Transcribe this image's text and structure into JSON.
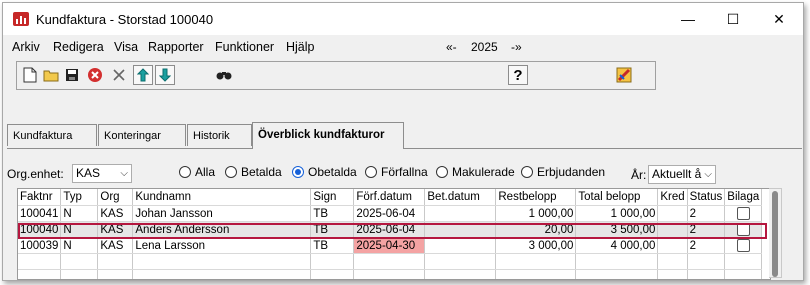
{
  "window": {
    "title": "Kundfaktura - Storstad 100040"
  },
  "menu": [
    "Arkiv",
    "Redigera",
    "Visa",
    "Rapporter",
    "Funktioner",
    "Hjälp"
  ],
  "year_nav": {
    "prev": "«-",
    "year": "2025",
    "next": "-»"
  },
  "toolbar": {
    "icons": [
      "new-document-icon",
      "open-folder-icon",
      "save-icon",
      "delete-icon",
      "cancel-icon",
      "move-up-icon",
      "move-down-icon",
      "search-icon",
      "help-icon",
      "settings-icon"
    ]
  },
  "tabs": [
    "Kundfaktura",
    "Konteringar",
    "Historik",
    "Överblick kundfakturor"
  ],
  "filters": {
    "org_label": "Org.enhet:",
    "org_value": "KAS",
    "radios": [
      {
        "label": "Alla",
        "checked": false
      },
      {
        "label": "Betalda",
        "checked": false
      },
      {
        "label": "Obetalda",
        "checked": true
      },
      {
        "label": "Förfallna",
        "checked": false
      },
      {
        "label": "Makulerade",
        "checked": false
      },
      {
        "label": "Erbjudanden",
        "checked": false
      }
    ],
    "year_label": "År:",
    "year_value": "Aktuellt år"
  },
  "grid": {
    "columns": [
      "Faktnr",
      "Typ",
      "Org",
      "Kundnamn",
      "Sign",
      "Förf.datum",
      "Bet.datum",
      "Restbelopp",
      "Total belopp",
      "Kred",
      "Status",
      "Bilaga"
    ],
    "rows": [
      [
        "100041",
        "N",
        "KAS",
        "Johan Jansson",
        "TB",
        "2025-06-04",
        "",
        "1 000,00",
        "1 000,00",
        "",
        "2",
        ""
      ],
      [
        "100040",
        "N",
        "KAS",
        "Anders Andersson",
        "TB",
        "2025-06-04",
        "",
        "20,00",
        "3 500,00",
        "",
        "2",
        ""
      ],
      [
        "100039",
        "N",
        "KAS",
        "Lena Larsson",
        "TB",
        "2025-04-30",
        "",
        "3 000,00",
        "4 000,00",
        "",
        "2",
        ""
      ]
    ],
    "selected_row": 1,
    "overdue_row": 2,
    "colors": {
      "selection": "#b5173f",
      "overdue": "#f4a3a3"
    }
  }
}
